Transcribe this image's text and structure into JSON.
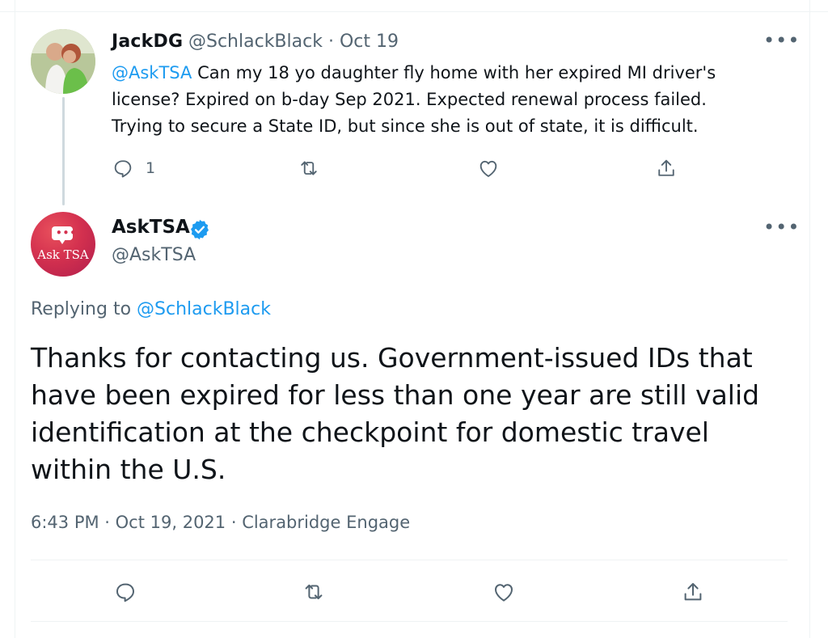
{
  "parent_tweet": {
    "author_name": "JackDG",
    "handle": "@SchlackBlack",
    "date": "Oct 19",
    "mention": "@AskTSA",
    "text": "Can my 18 yo daughter fly home with her expired MI driver's license? Expired on b-day Sep 2021. Expected renewal process failed. Trying to secure a State ID, but since she is out of state, it is difficult.",
    "reply_count": "1",
    "more_label": "•••"
  },
  "main_tweet": {
    "author_name": "AskTSA",
    "handle": "@AskTSA",
    "avatar_text": "Ask TSA",
    "replying_prefix": "Replying to",
    "replying_handle": "@SchlackBlack",
    "text": "Thanks for contacting us. Government-issued IDs that have been expired for less than one year are still valid identification at the checkpoint for domestic travel within the U.S.",
    "time": "6:43 PM",
    "date": "Oct 19, 2021",
    "source": "Clarabridge Engage",
    "more_label": "•••"
  },
  "icons": {
    "reply": "reply-icon",
    "retweet": "retweet-icon",
    "like": "heart-icon",
    "share": "share-icon",
    "verified": "verified-badge-icon"
  },
  "colors": {
    "link": "#1d9bf0",
    "muted": "#536471",
    "text": "#0f1419",
    "avatar_brand": "#d4314f"
  }
}
